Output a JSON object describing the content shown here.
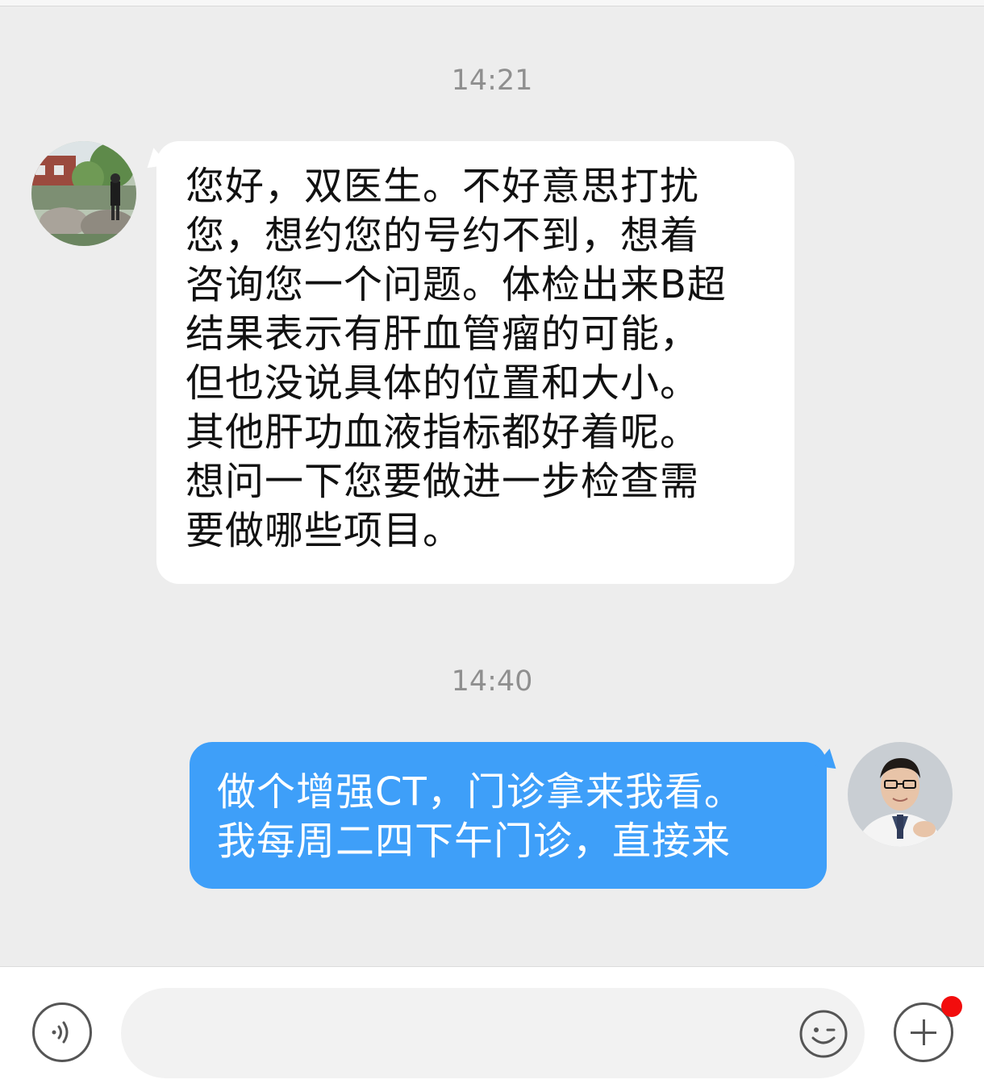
{
  "messages": [
    {
      "time": "14:21",
      "sender": "patient",
      "lines": [
        "您好，双医生。不好意思打扰",
        "您，想约您的号约不到，想着",
        "咨询您一个问题。体检出来B超",
        "结果表示有肝血管瘤的可能，",
        "但也没说具体的位置和大小。",
        "其他肝功血液指标都好着呢。",
        "想问一下您要做进一步检查需",
        "要做哪些项目。"
      ]
    },
    {
      "time": "14:40",
      "sender": "doctor",
      "lines": [
        "做个增强CT，门诊拿来我看。",
        "我每周二四下午门诊，直接来"
      ]
    }
  ],
  "input_bar": {
    "value": "",
    "placeholder": "",
    "voice_icon": "voice-icon",
    "emoji_icon": "emoji-icon",
    "plus_icon": "plus-icon",
    "notification_dot_color": "#f20d0d"
  },
  "colors": {
    "background": "#ededed",
    "incoming_bubble": "#ffffff",
    "outgoing_bubble": "#3e9ff9"
  }
}
